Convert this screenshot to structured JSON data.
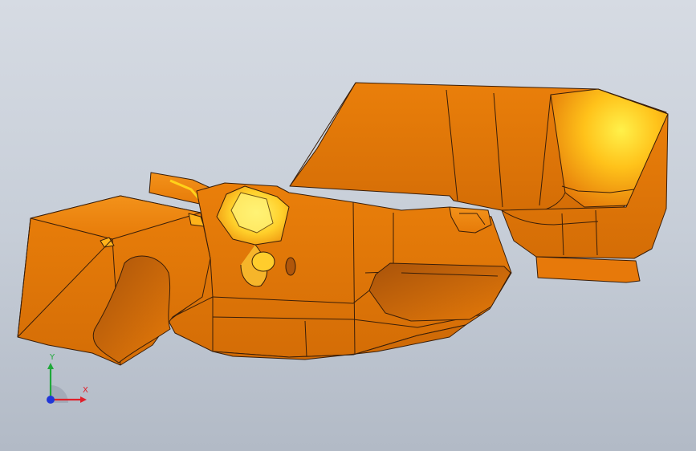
{
  "colors": {
    "background_top": "#d6dbe3",
    "background_bottom": "#b2bac6",
    "part_base": "#e87d08",
    "part_shadow": "#c2620a",
    "part_highlight": "#ffd21a",
    "edge": "#3a1e08",
    "axis_x": "#e0202a",
    "axis_y": "#1fa83a",
    "axis_z": "#2036d8"
  },
  "triad": {
    "x_label": "X",
    "y_label": "Y"
  }
}
